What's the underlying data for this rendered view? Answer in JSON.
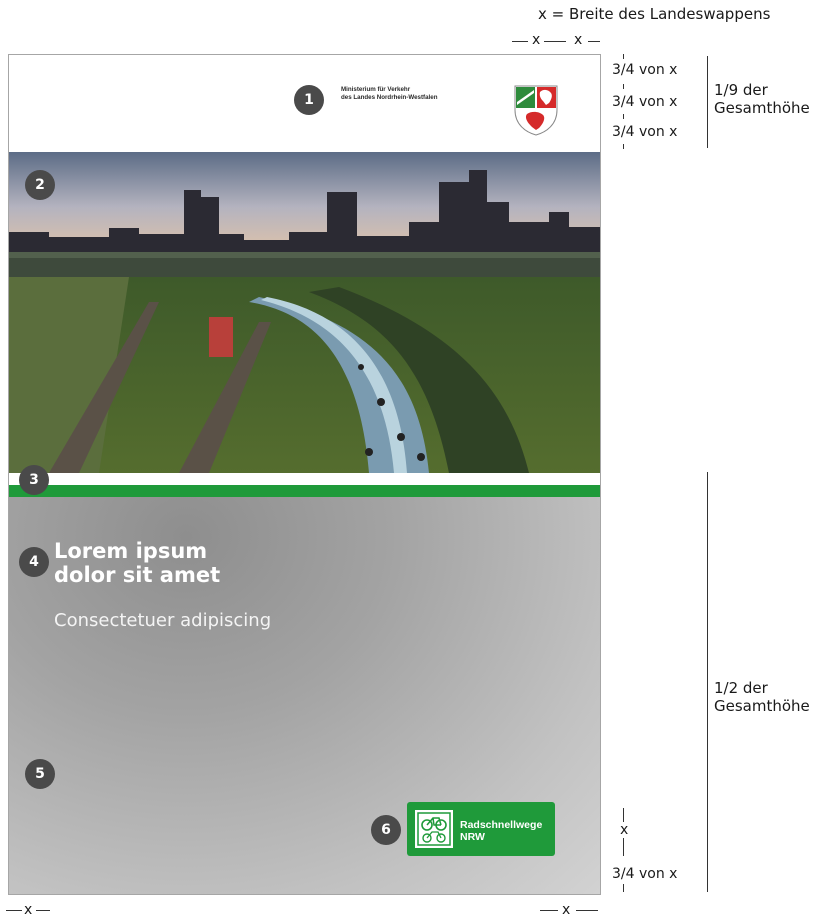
{
  "annotations": {
    "width_definition": "x = Breite des Landeswappens",
    "x_left": "x",
    "x_right": "x",
    "three_quarter_1": "3/4 von x",
    "three_quarter_2": "3/4 von x",
    "three_quarter_3": "3/4 von x",
    "ninth_line1": "1/9 der",
    "ninth_line2": "Gesamthöhe",
    "half_line1": "1/2 der",
    "half_line2": "Gesamthöhe",
    "x_bottom_marker": "x",
    "three_quarter_bottom": "3/4 von x",
    "bottom_x_left": "x",
    "bottom_x_right": "x"
  },
  "poster": {
    "ministry_line1": "Ministerium für Verkehr",
    "ministry_line2": "des Landes Nordrhein-Westfalen",
    "headline_line1": "Lorem ipsum",
    "headline_line2": "dolor sit amet",
    "subline": "Consectetuer adipiscing",
    "logo_line1": "Radschnellwege",
    "logo_line2": "NRW",
    "brand_green": "#1f9a3a"
  },
  "badges": [
    "1",
    "2",
    "3",
    "4",
    "5",
    "6"
  ]
}
